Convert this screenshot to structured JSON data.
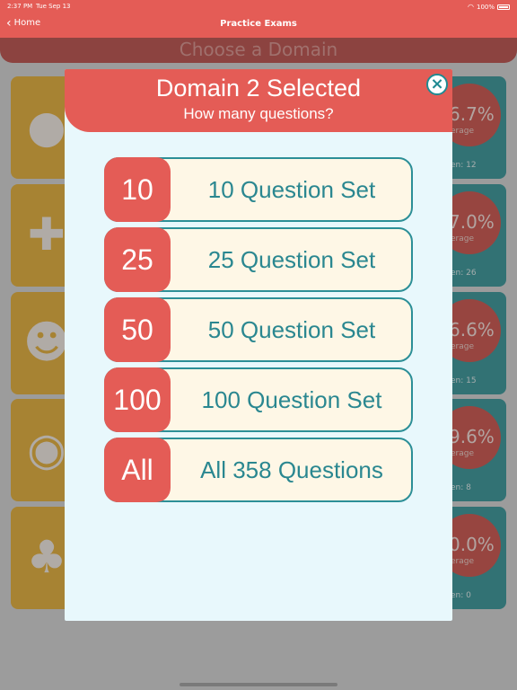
{
  "status": {
    "time": "2:37 PM",
    "date": "Tue Sep 13",
    "battery": "100%"
  },
  "nav": {
    "back_label": "Home",
    "title": "Practice Exams"
  },
  "background": {
    "title": "Choose a Domain",
    "tiles": [
      {
        "pct": "6.7%",
        "avg": "erage",
        "taken": "en: 12"
      },
      {
        "pct": "7.0%",
        "avg": "erage",
        "taken": "en: 26"
      },
      {
        "pct": "6.6%",
        "avg": "erage",
        "taken": "en: 15"
      },
      {
        "pct": "9.6%",
        "avg": "erage",
        "taken": "en: 8"
      },
      {
        "pct": "0.0%",
        "avg": "erage",
        "taken": "en: 0"
      }
    ]
  },
  "modal": {
    "title": "Domain 2 Selected",
    "subtitle": "How many questions?",
    "close_icon": "close-icon",
    "options": [
      {
        "badge": "10",
        "label": "10 Question Set"
      },
      {
        "badge": "25",
        "label": "25 Question Set"
      },
      {
        "badge": "50",
        "label": "50 Question Set"
      },
      {
        "badge": "100",
        "label": "100 Question Set"
      },
      {
        "badge": "All",
        "label": "All 358 Questions"
      }
    ]
  },
  "colors": {
    "accent": "#e45c56",
    "teal": "#2c8f97",
    "cream": "#fef7e6",
    "modal_bg": "#e8f8fc"
  }
}
